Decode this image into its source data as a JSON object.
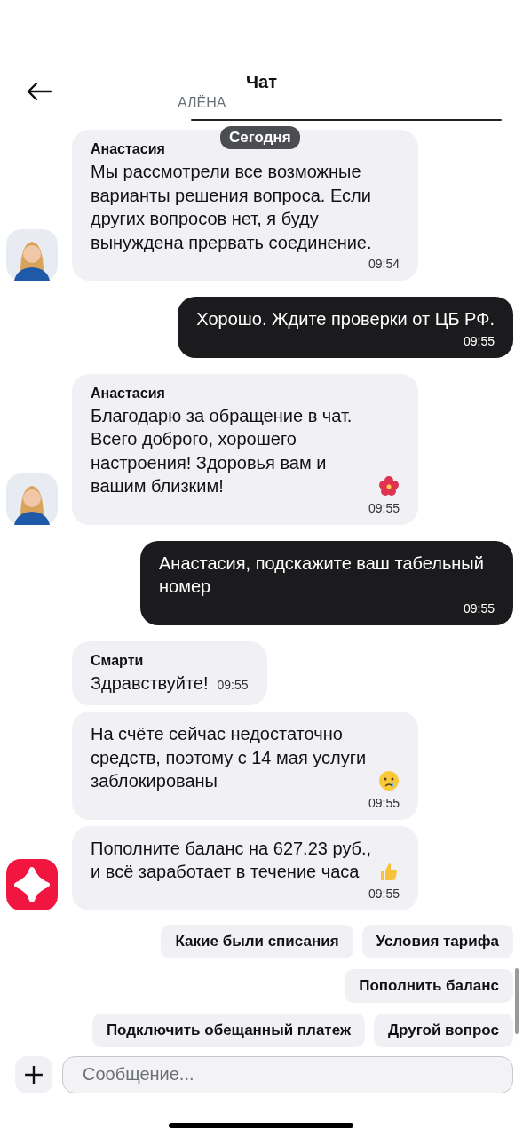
{
  "header": {
    "title": "Чат",
    "name": "АЛЁНА"
  },
  "date_badge": "Сегодня",
  "messages": [
    {
      "kind": "incoming",
      "sender": "Анастасия",
      "text": "Мы рассмотрели все возможные варианты решения вопроса. Если других вопросов нет, я буду вынуждена прервать соединение.",
      "time": "09:54",
      "avatar": {
        "kind": "person"
      },
      "time_inline": false
    },
    {
      "kind": "outgoing",
      "text": "Хорошо. Ждите проверки от ЦБ РФ.",
      "time": "09:55",
      "time_inline": false
    },
    {
      "kind": "incoming",
      "sender": "Анастасия",
      "text": "Благодарю за обращение в чат. Всего доброго, хорошего настроения! Здоровья вам и вашим близким!",
      "emoji": {
        "kind": "flower"
      },
      "time": "09:55",
      "avatar": {
        "kind": "person"
      },
      "time_inline": false
    },
    {
      "kind": "outgoing",
      "text": "Анастасия, подскажите ваш табельный номер",
      "time": "09:55",
      "time_inline": false
    },
    {
      "kind": "incoming",
      "sender": "Смарти",
      "text": "Здравствуйте!",
      "time": "09:55",
      "time_inline": true
    },
    {
      "kind": "incoming",
      "text": "На счёте сейчас недостаточно средств, поэтому с 14 мая услуги заблокированы",
      "emoji": {
        "kind": "crying"
      },
      "time": "09:55",
      "time_inline": false
    },
    {
      "kind": "incoming",
      "text": "Пополните баланс на 627.23 руб., и всё заработает в течение часа",
      "emoji": {
        "kind": "thumbs"
      },
      "time": "09:55",
      "avatar": {
        "kind": "logo"
      },
      "time_inline": false
    }
  ],
  "quick_replies": [
    [
      "Какие были списания",
      "Условия тарифа"
    ],
    [
      "Пополнить баланс"
    ],
    [
      "Подключить обещанный платеж",
      "Другой вопрос"
    ]
  ],
  "composer": {
    "placeholder": "Сообщение..."
  }
}
